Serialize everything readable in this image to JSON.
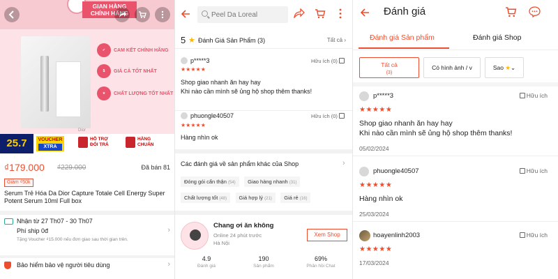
{
  "colors": {
    "accent": "#ee4d2d",
    "star": "#ee4d2d",
    "hero_pink": "#fde3e7",
    "brand_pink": "#e9536b",
    "promo_navy": "#0d1f6b",
    "promo_yellow": "#ffd400"
  },
  "panel1": {
    "banner": {
      "badge_line1": "GIAN HÀNG",
      "badge_line2": "CHÍNH HÃNG"
    },
    "claims": [
      "CAM KẾT CHÍNH HÃNG",
      "GIÁ CẢ TỐT NHẤT",
      "CHẤT LƯỢNG TỐT NHẤT"
    ],
    "brand_mark": "Dior",
    "promo": {
      "date": "25.7",
      "voucher": "VOUCHER",
      "voucher_sub": "XTRA",
      "support_line1": "HỖ TRỢ",
      "support_line2": "ĐỔI TRẢ",
      "genuine_line1": "HÀNG",
      "genuine_line2": "CHUẨN"
    },
    "price": "₫179.000",
    "price_original": "₫229.000",
    "sold": "Đã bán 81",
    "discount_label": "Giảm ₫50k",
    "product_title": "Serum Trẻ Hóa Da Dior Capture Totale Cell Energy Super Potent Serum 10ml Full box",
    "shipping": {
      "eta": "Nhận từ 27 Th07 - 30 Th07",
      "fee": "Phí ship 0đ",
      "note": "Tặng Voucher ₫15.000 nếu đơn giao sau thời gian trên."
    },
    "insurance": "Bảo hiểm bảo vệ người tiêu dùng"
  },
  "panel2": {
    "search_placeholder": "Peel Da Loreal",
    "rating_value": "5",
    "rating_label": "Đánh Giá Sản Phẩm",
    "rating_count": "(3)",
    "see_all": "Tất cả",
    "reviews": [
      {
        "user": "p*****3",
        "helpful": "Hữu ích (0)",
        "stars": "★★★★★",
        "body": "Shop giao nhanh ăn hay hay\nKhi nào cần mình sẽ ủng hộ shop thêm thanks!"
      },
      {
        "user": "phuongle40507",
        "helpful": "Hữu ích (0)",
        "stars": "★★★★★",
        "body": "Hàng nhìn ok"
      }
    ],
    "other_reviews_title": "Các đánh giá về sản phẩm khác của Shop",
    "tags": [
      {
        "label": "Đóng gói cẩn thận",
        "count": "(54)"
      },
      {
        "label": "Giao hàng nhanh",
        "count": "(31)"
      },
      {
        "label": "Chất lượng tốt",
        "count": "(48)"
      },
      {
        "label": "Giá hợp lý",
        "count": "(21)"
      },
      {
        "label": "Giá rẻ",
        "count": "(16)"
      }
    ],
    "shop": {
      "name": "Chang ơi ăn không",
      "online": "Online 24 phút trước",
      "location": "Hà Nội",
      "view_button": "Xem Shop",
      "stats": [
        {
          "value": "4.9",
          "label": "Đánh giá"
        },
        {
          "value": "190",
          "label": "Sản phẩm"
        },
        {
          "value": "69%",
          "label": "Phản hồi Chat"
        }
      ]
    }
  },
  "panel3": {
    "title": "Đánh giá",
    "tabs": [
      "Đánh giá Sản phẩm",
      "Đánh giá Shop"
    ],
    "filters": [
      {
        "label": "Tất cả",
        "sub": "(3)"
      },
      {
        "label": "Có hình ảnh / v",
        "sub": ""
      },
      {
        "label": "Sao",
        "sub": ""
      }
    ],
    "helpful_label": "Hữu ích",
    "reviews": [
      {
        "user": "p*****3",
        "stars": "★★★★★",
        "body": "Shop giao nhanh ăn hay hay\nKhi nào cần mình sẽ ủng hộ shop thêm thanks!",
        "date": "05/02/2024"
      },
      {
        "user": "phuongle40507",
        "stars": "★★★★★",
        "body": "Hàng nhìn ok",
        "date": "25/03/2024"
      },
      {
        "user": "hoayenlinh2003",
        "stars": "★★★★★",
        "body": "",
        "date": "17/03/2024"
      }
    ]
  }
}
